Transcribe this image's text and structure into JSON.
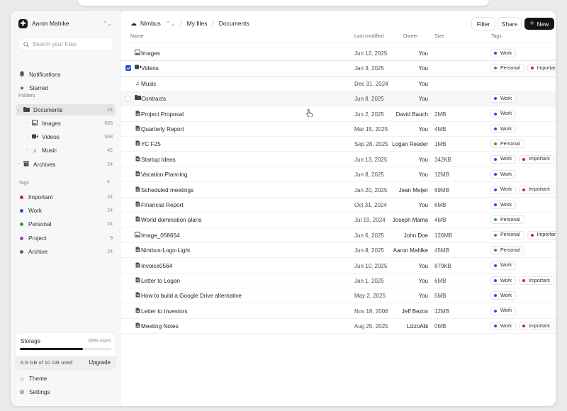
{
  "account": {
    "name": "Aaron Mahlke",
    "logo_glyph": "✚"
  },
  "search": {
    "placeholder": "Search your Files"
  },
  "nav": [
    {
      "label": "Notifications",
      "icon": "bell-icon"
    },
    {
      "label": "Starred",
      "icon": "star-icon"
    }
  ],
  "folders": {
    "section_label": "Folders",
    "items": [
      {
        "label": "Documents",
        "count": "24",
        "icon": "folder-icon",
        "active": true
      },
      {
        "label": "Images",
        "count": "865",
        "icon": "image-icon"
      },
      {
        "label": "Videos",
        "count": "568",
        "icon": "video-icon"
      },
      {
        "label": "Music",
        "count": "42",
        "icon": "music-icon"
      },
      {
        "label": "Archives",
        "count": "24",
        "icon": "archive-icon"
      }
    ]
  },
  "tags": {
    "section_label": "Tags",
    "add_glyph": "+",
    "items": [
      {
        "label": "Important",
        "count": "24",
        "color": "#c0282d"
      },
      {
        "label": "Work",
        "count": "24",
        "color": "#2f4ad9"
      },
      {
        "label": "Personal",
        "count": "24",
        "color": "#2f9e44"
      },
      {
        "label": "Project",
        "count": "9",
        "color": "#8e3fd1"
      },
      {
        "label": "Archive",
        "count": "24",
        "color": "#5c6169"
      }
    ]
  },
  "storage": {
    "title": "Storage",
    "percent_label": "69% used",
    "used_fraction": 0.69,
    "used_label": "6.9 GB of 10 GB used",
    "upgrade_label": "Upgrade"
  },
  "bottom_nav": [
    {
      "label": "Theme",
      "icon": "sun-icon"
    },
    {
      "label": "Settings",
      "icon": "gear-icon"
    }
  ],
  "breadcrumb": {
    "workspace": "Nimbus",
    "level1": "My files",
    "level2": "Documents"
  },
  "toolbar": {
    "filter_label": "Filter",
    "share_label": "Share",
    "new_label": "New"
  },
  "table": {
    "headers": {
      "name": "Name",
      "modified": "Last modified",
      "owner": "Owner",
      "size": "Size",
      "tags": "Tags"
    },
    "rows": [
      {
        "name": "Images",
        "type": "image-folder",
        "modified": "Jun 12, 2025",
        "owner": "You",
        "size": "",
        "tags": [
          "Work"
        ]
      },
      {
        "name": "Videos",
        "type": "video-folder",
        "modified": "Jan 3, 2025",
        "owner": "You",
        "size": "",
        "tags": [
          "Personal",
          "Important"
        ],
        "selected": true
      },
      {
        "name": "Music",
        "type": "music-folder",
        "modified": "Dec 31, 2024",
        "owner": "You",
        "size": "",
        "tags": []
      },
      {
        "name": "Contracts",
        "type": "folder",
        "modified": "Jun 8, 2025",
        "owner": "You",
        "size": "",
        "tags": [
          "Work"
        ],
        "hover": true
      },
      {
        "name": "Project Proposal",
        "type": "file",
        "modified": "Jun 2, 2025",
        "owner": "David Bauch",
        "size": "2MB",
        "tags": [
          "Work"
        ]
      },
      {
        "name": "Quarterly Report",
        "type": "file",
        "modified": "Mar 15, 2025",
        "owner": "You",
        "size": "4MB",
        "tags": [
          "Work"
        ]
      },
      {
        "name": "YC F25",
        "type": "file",
        "modified": "Sep 28, 2025",
        "owner": "Logan Reeder",
        "size": "1MB",
        "tags": [
          "Personal"
        ]
      },
      {
        "name": "Startup Ideas",
        "type": "file",
        "modified": "Jun 13, 2025",
        "owner": "You",
        "size": "342KB",
        "tags": [
          "Work",
          "Important"
        ]
      },
      {
        "name": "Vacation Planning",
        "type": "file",
        "modified": "Jun 8, 2025",
        "owner": "You",
        "size": "12MB",
        "tags": [
          "Work"
        ]
      },
      {
        "name": "Scheduled meetings",
        "type": "file",
        "modified": "Jan 20, 2025",
        "owner": "Jean Meijer",
        "size": "69MB",
        "tags": [
          "Work",
          "Important"
        ]
      },
      {
        "name": "Financial Report",
        "type": "file",
        "modified": "Oct 31, 2024",
        "owner": "You",
        "size": "6MB",
        "tags": [
          "Work"
        ]
      },
      {
        "name": "World domination plans",
        "type": "file",
        "modified": "Jul 19, 2024",
        "owner": "Joseph Mama",
        "size": "4MB",
        "tags": [
          "Personal"
        ]
      },
      {
        "name": "Image_058654",
        "type": "image",
        "modified": "Jun 6, 2025",
        "owner": "John Doe",
        "size": "126MB",
        "tags": [
          "Personal",
          "Important"
        ]
      },
      {
        "name": "Nimbus-Logo-Light",
        "type": "file",
        "modified": "Jun 8, 2025",
        "owner": "Aaron Mahlke",
        "size": "45MB",
        "tags": [
          "Personal"
        ]
      },
      {
        "name": "Invoice0564",
        "type": "file",
        "modified": "Jun 10, 2025",
        "owner": "You",
        "size": "879KB",
        "tags": [
          "Work"
        ]
      },
      {
        "name": "Letter to Logan",
        "type": "file",
        "modified": "Jan 1, 2025",
        "owner": "You",
        "size": "6MB",
        "tags": [
          "Work",
          "Important"
        ]
      },
      {
        "name": "How to build a Google Drive alternative",
        "type": "file",
        "modified": "May 2, 2025",
        "owner": "You",
        "size": "5MB",
        "tags": [
          "Work"
        ]
      },
      {
        "name": "Letter to Investors",
        "type": "file",
        "modified": "Nov 18, 2006",
        "owner": "Jeff Bezos",
        "size": "12MB",
        "tags": [
          "Work"
        ]
      },
      {
        "name": "Meeting Notes",
        "type": "file",
        "modified": "Aug 25, 2025",
        "owner": "LizzoAbi",
        "size": "0MB",
        "tags": [
          "Work",
          "Important"
        ]
      }
    ]
  },
  "tag_colors": {
    "Work": "#2f4ad9",
    "Personal": "#2f9e44",
    "Important": "#c0282d"
  }
}
